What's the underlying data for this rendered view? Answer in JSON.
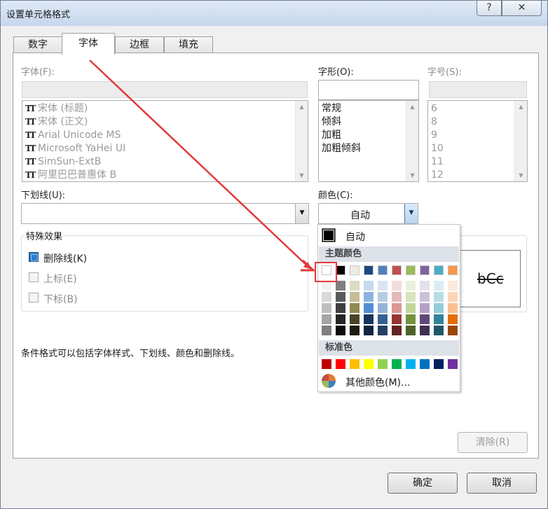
{
  "window": {
    "title": "设置单元格格式",
    "help_glyph": "?",
    "close_glyph": "✕"
  },
  "tabs": [
    {
      "label": "数字",
      "active": false
    },
    {
      "label": "字体",
      "active": true
    },
    {
      "label": "边框",
      "active": false
    },
    {
      "label": "填充",
      "active": false
    }
  ],
  "font": {
    "label": "字体(F):",
    "value": "",
    "items": [
      "宋体 (标题)",
      "宋体 (正文)",
      "Arial Unicode MS",
      "Microsoft YaHei UI",
      "SimSun-ExtB",
      "阿里巴巴普惠体 B"
    ]
  },
  "style": {
    "label": "字形(O):",
    "value": "",
    "items": [
      "常规",
      "倾斜",
      "加粗",
      "加粗倾斜"
    ]
  },
  "size": {
    "label": "字号(S):",
    "value": "",
    "items": [
      "6",
      "8",
      "9",
      "10",
      "11",
      "12"
    ]
  },
  "underline": {
    "label": "下划线(U):",
    "value": ""
  },
  "color": {
    "label": "颜色(C):",
    "value": "自动"
  },
  "effects": {
    "title": "特殊效果",
    "strikethrough": {
      "label": "删除线(K)",
      "checked": true
    },
    "superscript": {
      "label": "上标(E)",
      "checked": false
    },
    "subscript": {
      "label": "下标(B)",
      "checked": false
    }
  },
  "preview": {
    "text": "bCc"
  },
  "note": "条件格式可以包括字体样式、下划线、颜色和删除线。",
  "buttons": {
    "clear": "清除(R)",
    "ok": "确定",
    "cancel": "取消"
  },
  "color_popup": {
    "auto_label": "自动",
    "theme_heading": "主题颜色",
    "standard_heading": "标准色",
    "other_label": "其他颜色(M)...",
    "theme_top": [
      "#FFFFFF",
      "#000000",
      "#EEECE1",
      "#1F497D",
      "#4F81BD",
      "#C0504D",
      "#9BBB59",
      "#8064A2",
      "#4BACC6",
      "#F79646"
    ],
    "theme_shades": [
      [
        "#F2F2F2",
        "#7F7F7F",
        "#DDD9C3",
        "#C6D9F0",
        "#DBE5F1",
        "#F2DCDB",
        "#EBF1DD",
        "#E5E0EC",
        "#DBEEF3",
        "#FDEADA"
      ],
      [
        "#D8D8D8",
        "#595959",
        "#C4BD97",
        "#8DB3E2",
        "#B8CCE4",
        "#E5B9B7",
        "#D7E3BC",
        "#CCC1D9",
        "#B7DDE8",
        "#FBD5B5"
      ],
      [
        "#BFBFBF",
        "#3F3F3F",
        "#938953",
        "#548DD4",
        "#95B3D7",
        "#D99694",
        "#C3D69B",
        "#B2A2C7",
        "#92CDDC",
        "#FAC08F"
      ],
      [
        "#A5A5A5",
        "#262626",
        "#494429",
        "#17365D",
        "#366092",
        "#953734",
        "#76923C",
        "#5F497A",
        "#31859B",
        "#E36C09"
      ],
      [
        "#7F7F7F",
        "#0C0C0C",
        "#1D1B10",
        "#0F243E",
        "#244061",
        "#632423",
        "#4F6128",
        "#3F3151",
        "#205867",
        "#974806"
      ]
    ],
    "standard": [
      "#C00000",
      "#FF0000",
      "#FFC000",
      "#FFFF00",
      "#92D050",
      "#00B050",
      "#00B0F0",
      "#0070C0",
      "#002060",
      "#7030A0"
    ]
  },
  "annotation_color": "#E23A3A"
}
